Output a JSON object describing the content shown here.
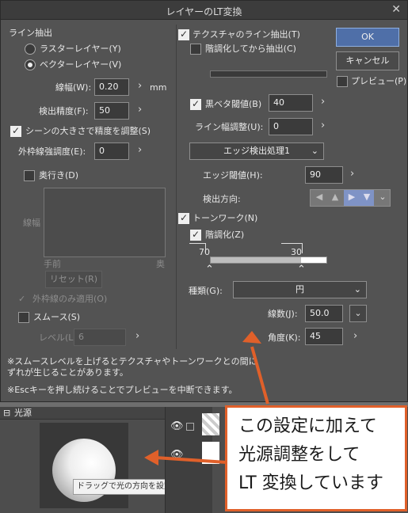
{
  "dialog": {
    "title": "レイヤーのLT変換",
    "close": "✕"
  },
  "left": {
    "line_extract_label": "ライン抽出",
    "raster_layer": "ラスターレイヤー(Y)",
    "vector_layer": "ベクターレイヤー(V)",
    "line_width_label": "線幅(W):",
    "line_width_value": "0.20",
    "line_width_unit": "mm",
    "detect_precision_label": "検出精度(F):",
    "detect_precision_value": "50",
    "scene_size_label": "シーンの大きさで精度を調整(S)",
    "outline_emphasis_label": "外枠線強調度(E):",
    "outline_emphasis_value": "0",
    "depth_label": "奥行き(D)",
    "graph_y_label": "線幅",
    "graph_front": "手前",
    "graph_back": "奥",
    "reset_button": "リセット(R)",
    "outline_only_label": "外枠線のみ適用(O)",
    "smooth_label": "スムース(S)",
    "level_label": "レベル(L):",
    "level_value": "6"
  },
  "middle": {
    "texture_line_label": "テクスチャのライン抽出(T)",
    "gradation_extract_label": "階調化してから抽出(C)",
    "black_threshold_label": "黒ベタ閾値(B)",
    "black_threshold_value": "40",
    "line_width_adjust_label": "ライン幅調整(U):",
    "line_width_adjust_value": "0",
    "edge_process_select": "エッジ検出処理1",
    "edge_threshold_label": "エッジ閾値(H):",
    "edge_threshold_value": "90",
    "detect_direction_label": "検出方向:",
    "tone_work_label": "トーンワーク(N)",
    "gradation_label": "階調化(Z)",
    "slider_left_value": "70",
    "slider_right_value": "30",
    "kind_label": "種類(G):",
    "kind_value": "円",
    "line_count_label": "線数(J):",
    "line_count_value": "50.0",
    "angle_label": "角度(K):",
    "angle_value": "45"
  },
  "right": {
    "ok_button": "OK",
    "cancel_button": "キャンセル",
    "preview_label": "プレビュー(P)"
  },
  "notes": {
    "note1_line1": "※スムースレベルを上げるとテクスチャやトーンワークとの間に",
    "note1_line2": "ずれが生じることがあります。",
    "note2": "※Escキーを押し続けることでプレビューを中断できます。"
  },
  "light_panel": {
    "header": "光源",
    "tooltip": "ドラッグで光の方向を設定します"
  },
  "callout": {
    "line1": "この設定に加えて",
    "line2": "光源調整をして",
    "line3": "LT 変換しています"
  },
  "colors": {
    "accent_arrow": "#e0602a",
    "ok_button": "#4f6fa8"
  }
}
